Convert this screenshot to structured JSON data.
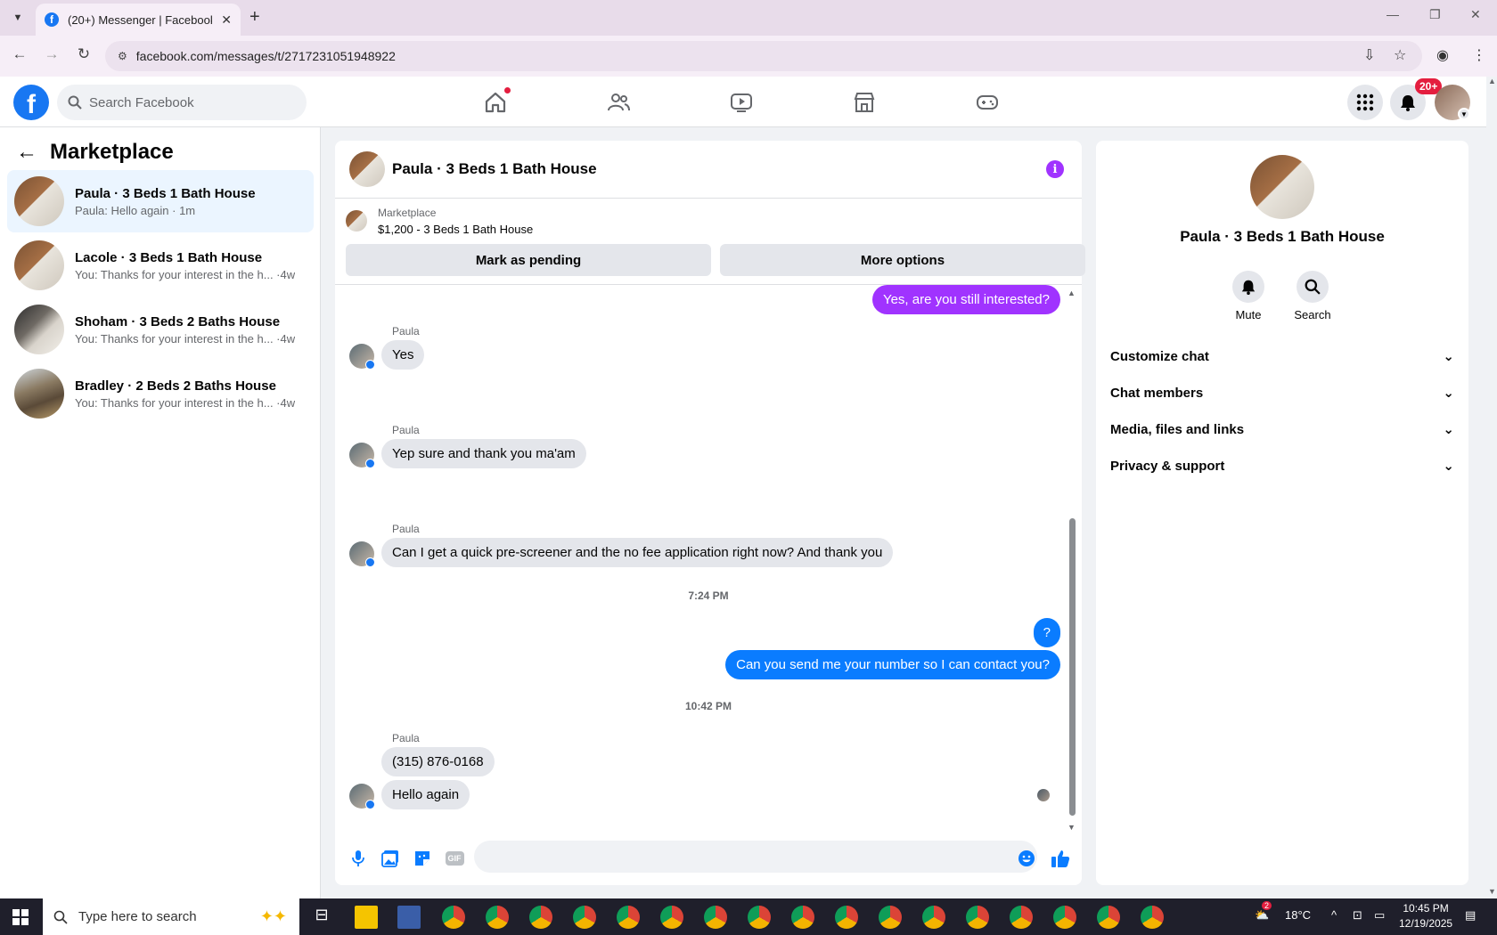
{
  "browser": {
    "tab_title": "(20+) Messenger | Facebook",
    "url": "facebook.com/messages/t/2717231051948922"
  },
  "header": {
    "search_placeholder": "Search Facebook",
    "notification_badge": "20+"
  },
  "sidebar": {
    "title": "Marketplace",
    "conversations": [
      {
        "name": "Paula · 3 Beds 1 Bath House",
        "preview": "Paula: Hello again · 1m",
        "active": true
      },
      {
        "name": "Lacole · 3 Beds 1 Bath House",
        "preview": "You: Thanks for your interest in the h... ·4w",
        "active": false
      },
      {
        "name": "Shoham · 3 Beds 2 Baths House",
        "preview": "You: Thanks for your interest in the h... ·4w",
        "active": false
      },
      {
        "name": "Bradley · 2 Beds 2 Baths House",
        "preview": "You: Thanks for your interest in the h... ·4w",
        "active": false
      }
    ]
  },
  "chat": {
    "title": "Paula · 3 Beds 1 Bath House",
    "marketplace_label": "Marketplace",
    "listing": "$1,200 - 3 Beds 1 Bath House",
    "mark_pending": "Mark as pending",
    "more_options": "More options",
    "messages": {
      "out_1": "Yes, are you still interested?",
      "sender": "Paula",
      "in_1": "Yes",
      "in_2": "Yep sure and thank you ma'am",
      "in_3": "Can I get a quick pre-screener and the no fee application right now? And thank you",
      "time_1": "7:24 PM",
      "out_2": "?",
      "out_3": "Can you send me your number so I can contact you?",
      "time_2": "10:42 PM",
      "in_4": "(315) 876-0168",
      "in_5": "Hello again"
    },
    "composer_placeholder": "",
    "gif_label": "GIF"
  },
  "info_panel": {
    "name": "Paula · 3 Beds 1 Bath House",
    "mute": "Mute",
    "search": "Search",
    "rows": [
      "Customize chat",
      "Chat members",
      "Media, files and links",
      "Privacy & support"
    ]
  },
  "taskbar": {
    "search_placeholder": "Type here to search",
    "weather": "18°C",
    "time": "10:45 PM",
    "date": "12/19/2025",
    "notification_count": "2"
  },
  "colors": {
    "facebook_blue": "#1877f2",
    "messenger_blue": "#0a7cff",
    "messenger_purple": "#a033ff",
    "badge_red": "#e41e3f"
  }
}
